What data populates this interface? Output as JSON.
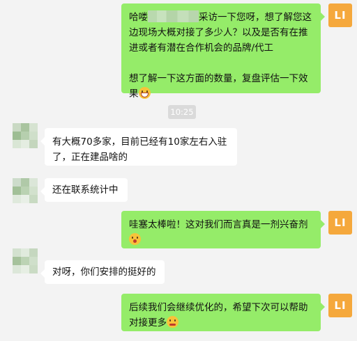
{
  "chat": {
    "timestamp": "10:25",
    "me_avatar_label": "LI",
    "messages": [
      {
        "sender": "me",
        "paragraphs": [
          {
            "before_redaction": "哈喽",
            "after_redaction": "采访一下您呀，想了解您这边现场大概对接了多少人？以及是否有在推进或者有潜在合作机会的品牌/代工"
          },
          {
            "text": "想了解一下这方面的数量，复盘评估一下效果",
            "emoji": "grinning-face"
          }
        ]
      },
      {
        "sender": "other",
        "text": "有大概70多家，目前已经有10家左右入驻了，正在建品啥的"
      },
      {
        "sender": "other",
        "text": "还在联系统计中"
      },
      {
        "sender": "me",
        "text": "哇塞太棒啦！这对我们而言真是一剂兴奋剂",
        "emoji": "surprised-face"
      },
      {
        "sender": "other",
        "text": "对呀，你们安排的挺好的"
      },
      {
        "sender": "me",
        "text": "后续我们会继续优化的，希望下次可以帮助对接更多",
        "emoji": "hand-over-mouth-face"
      }
    ]
  },
  "colors": {
    "background": "#f3f3f3",
    "outgoing_bubble": "#95ec69",
    "incoming_bubble": "#ffffff",
    "my_avatar": "#f5a83c",
    "timestamp_pill": "#dadada"
  }
}
